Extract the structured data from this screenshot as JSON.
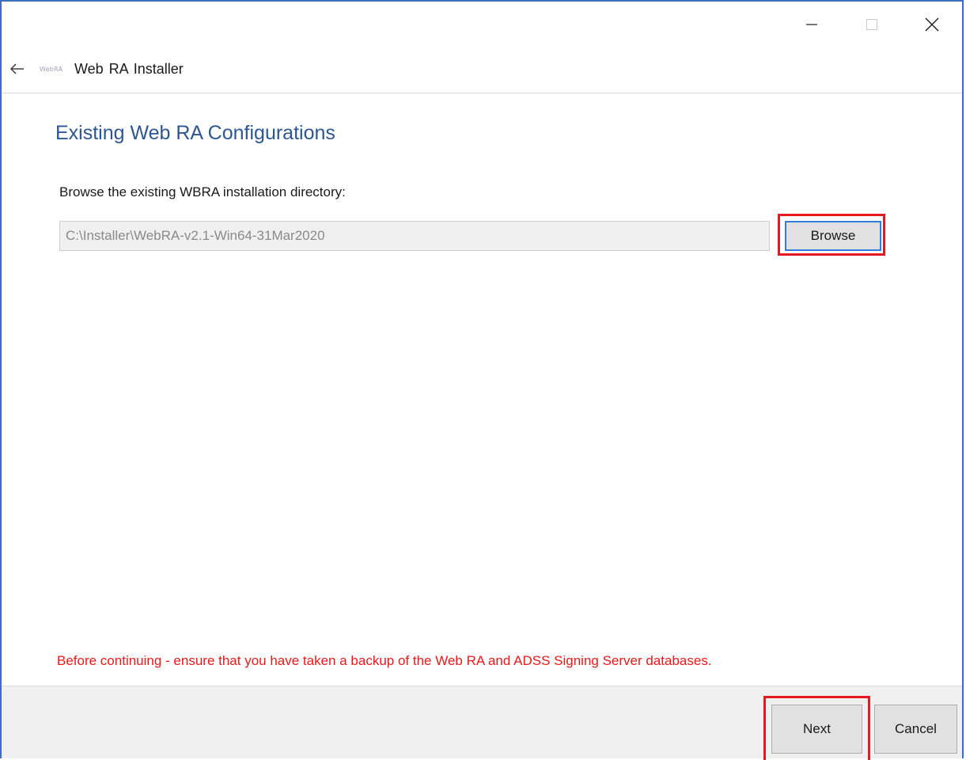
{
  "window": {
    "controls": {
      "minimize_icon": "minimize-icon",
      "maximize_icon": "maximize-icon",
      "close_icon": "close-icon"
    }
  },
  "appbar": {
    "back_icon": "back-arrow-icon",
    "logo_text": "WebRA",
    "title": "Web RA Installer"
  },
  "page": {
    "title": "Existing Web RA Configurations",
    "field_label": "Browse the existing WBRA installation directory:",
    "path_value": "C:\\Installer\\WebRA-v2.1-Win64-31Mar2020",
    "browse_label": "Browse",
    "warning": "Before continuing - ensure that you have taken a backup of the Web RA and ADSS Signing Server databases."
  },
  "footer": {
    "next_label": "Next",
    "cancel_label": "Cancel"
  },
  "colors": {
    "window_border": "#3a6fc4",
    "title_blue": "#2b5797",
    "warning_red": "#f21616",
    "highlight_red": "#e8191e",
    "focus_blue": "#2f7de1"
  }
}
